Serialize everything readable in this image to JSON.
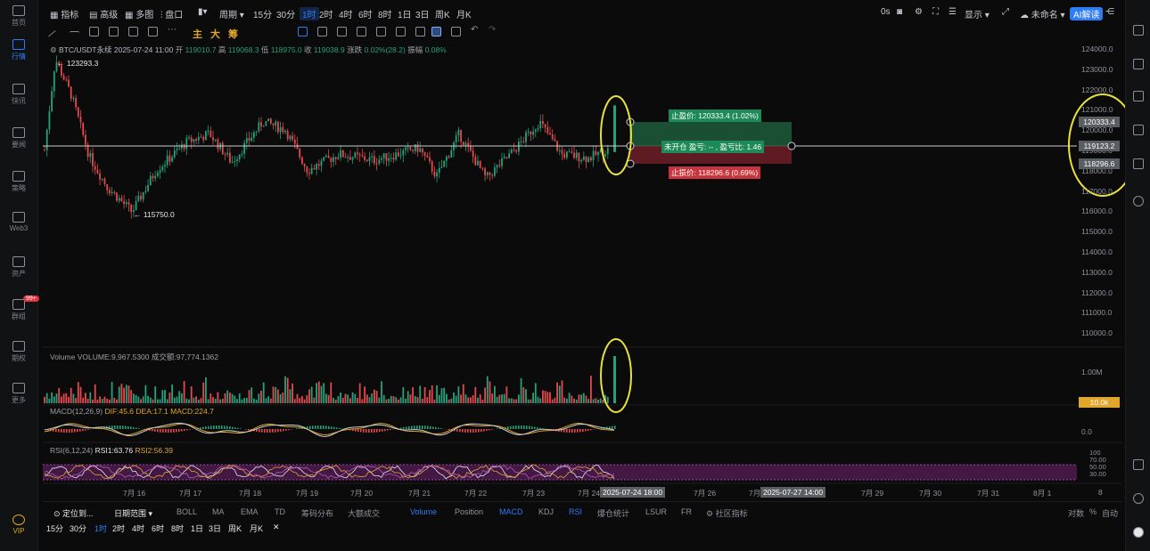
{
  "sidebar": {
    "items": [
      {
        "label": "首页",
        "icon": "home-icon"
      },
      {
        "label": "行情",
        "icon": "chart-icon",
        "active": true
      },
      {
        "label": "快讯",
        "icon": "news-icon"
      },
      {
        "label": "要闻",
        "icon": "headline-icon"
      },
      {
        "label": "策略",
        "icon": "strategy-icon"
      },
      {
        "label": "Web3",
        "icon": "web3-icon"
      },
      {
        "label": "资产",
        "icon": "wallet-icon"
      },
      {
        "label": "群组",
        "icon": "group-icon",
        "badge": "99+"
      },
      {
        "label": "期权",
        "icon": "options-icon"
      },
      {
        "label": "更多",
        "icon": "more-icon"
      },
      {
        "label": "VIP",
        "icon": "vip-icon"
      }
    ]
  },
  "topbar": {
    "indicator": "指标",
    "advanced": "高级",
    "multi": "多图",
    "market": "盘口",
    "period": "周期",
    "intervals": [
      "15分",
      "30分",
      "1时",
      "2时",
      "4时",
      "6时",
      "8时",
      "1日",
      "3日",
      "周K",
      "月K"
    ],
    "active_interval": "1时",
    "right": {
      "ms": "0s",
      "display": "显示",
      "unnamed": "未命名",
      "ai": "AI解读"
    }
  },
  "drawbar": {
    "labels": [
      "主",
      "大",
      "筹"
    ]
  },
  "legend": {
    "symbol": "BTC/USDT永续",
    "time": "2025-07-24 11:00",
    "open_label": "开",
    "open": "119010.7",
    "high_label": "高",
    "high": "119068.3",
    "low_label": "低",
    "low": "118975.0",
    "close_label": "收",
    "close": "119038.9",
    "change_label": "涨跌",
    "change": "0.02%(28.2)",
    "amp_label": "振幅",
    "amp": "0.08%"
  },
  "price_axis": {
    "ticks": [
      "124000.0",
      "123000.0",
      "122000.0",
      "121000.0",
      "120000.0",
      "119000.0",
      "118000.0",
      "117000.0",
      "116000.0",
      "115000.0",
      "114000.0",
      "113000.0",
      "112000.0",
      "111000.0",
      "110000.0"
    ],
    "boxes": {
      "take_profit": "120333.4",
      "current": "119123.2",
      "stop_loss": "118296.6"
    }
  },
  "annotations": {
    "high": "123293.3",
    "low": "115750.0"
  },
  "order": {
    "take_profit": "止盈价: 120333.4 (1.02%)",
    "entry": "未开仓 盈亏: -- , 盈亏比: 1.46",
    "stop_loss": "止损价: 118296.6 (0.69%)"
  },
  "volume": {
    "legend": "Volume VOLUME:9,967.5300  成交额:97,774.1362",
    "axis": [
      "1.00M"
    ],
    "last_box": "10.0k"
  },
  "macd": {
    "legend": "MACD(12,26,9)",
    "values": "DIF:45.6  DEA:17.1  MACD:224.7",
    "axis": "0.0"
  },
  "rsi": {
    "legend": "RSI(6,12,24)",
    "rsi1": "RSI1:63.76",
    "rsi2": "RSI2:56.39",
    "axis": [
      "100",
      "70.00",
      "50.00",
      "30.00"
    ]
  },
  "time_axis": {
    "ticks": [
      "7月 16",
      "7月 17",
      "7月 18",
      "7月 19",
      "7月 20",
      "7月 21",
      "7月 22",
      "7月 23",
      "7月 24",
      "7月 26",
      "7月 27",
      "7月 29",
      "7月 30",
      "7月 31",
      "8月 1",
      "8"
    ],
    "cursor_left": "2025-07-24 18:00",
    "cursor_right": "2025-07-27 14:00"
  },
  "bottombar": {
    "locate": "定位到...",
    "date_range": "日期范围",
    "indicators": [
      "BOLL",
      "MA",
      "EMA",
      "TD",
      "筹码分布",
      "大额成交",
      "Volume",
      "Position",
      "MACD",
      "KDJ",
      "RSI",
      "爆仓统计",
      "LSUR",
      "FR",
      "社区指标"
    ],
    "active_indicators": [
      "Volume",
      "MACD",
      "RSI"
    ],
    "right": [
      "对数",
      "%",
      "自动"
    ],
    "intervals": [
      "15分",
      "30分",
      "1时",
      "2时",
      "4时",
      "6时",
      "8时",
      "1日",
      "3日",
      "周K",
      "月K"
    ]
  },
  "colors": {
    "up": "#26a17b",
    "down": "#e5484d",
    "accent": "#2e7cf6",
    "highlight": "#e8e23a",
    "rsi_band": "#5b1f5c"
  }
}
